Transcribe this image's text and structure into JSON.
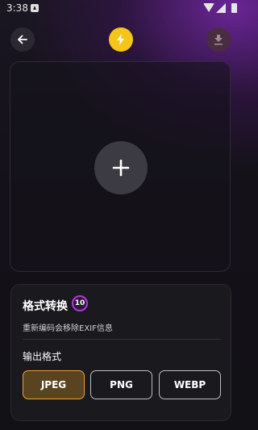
{
  "status_bar": {
    "time": "3:38",
    "icons": [
      "notification-icon",
      "wifi-icon",
      "signal-icon",
      "battery-icon"
    ]
  },
  "toolbar": {
    "back_icon": "arrow-left-icon",
    "action_icon": "lightning-bolt-icon",
    "download_icon": "download-icon"
  },
  "upload": {
    "icon": "plus-icon"
  },
  "card": {
    "title": "格式转换",
    "badge": "10",
    "description": "重新编码会移除EXIF信息",
    "section_label": "输出格式",
    "formats": [
      {
        "label": "JPEG",
        "selected": true
      },
      {
        "label": "PNG",
        "selected": false
      },
      {
        "label": "WEBP",
        "selected": false
      }
    ]
  },
  "colors": {
    "accent": "#f5c518",
    "selected_format": "#e8a43c",
    "badge_ring": "#b335e0"
  }
}
